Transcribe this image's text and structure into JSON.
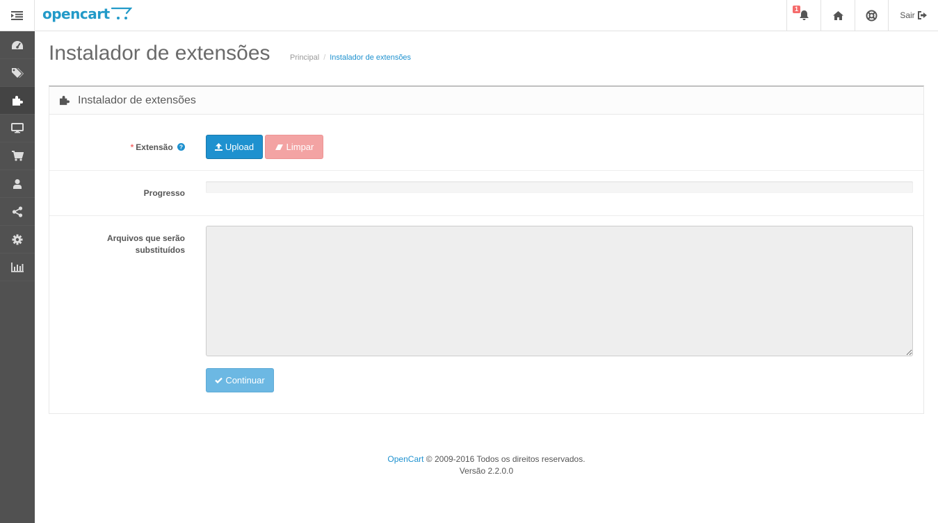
{
  "header": {
    "logo_text": "opencart",
    "notification_count": "1",
    "logout_label": "Sair"
  },
  "sidebar": {
    "items": [
      {
        "icon": "dashboard-icon"
      },
      {
        "icon": "tags-icon"
      },
      {
        "icon": "puzzle-icon",
        "active": true
      },
      {
        "icon": "desktop-icon"
      },
      {
        "icon": "cart-icon"
      },
      {
        "icon": "user-icon"
      },
      {
        "icon": "share-icon"
      },
      {
        "icon": "gear-icon"
      },
      {
        "icon": "bar-chart-icon"
      }
    ]
  },
  "page": {
    "title": "Instalador de extensões",
    "breadcrumb": {
      "home": "Principal",
      "separator": "/",
      "current": "Instalador de extensões"
    }
  },
  "panel": {
    "title": "Instalador de extensões",
    "extension_label": "Extensão",
    "required_mark": "*",
    "upload_label": "Upload",
    "clear_label": "Limpar",
    "progress_label": "Progresso",
    "progress_percent": 0,
    "files_label_line1": "Arquivos que serão",
    "files_label_line2": "substituídos",
    "files_value": "",
    "continue_label": "Continuar"
  },
  "footer": {
    "brand": "OpenCart",
    "copyright": "© 2009-2016 Todos os direitos reservados.",
    "version": "Versão 2.2.0.0"
  },
  "colors": {
    "primary": "#1e91cf",
    "danger": "#f56b6b",
    "sidebar_bg": "#515151"
  }
}
